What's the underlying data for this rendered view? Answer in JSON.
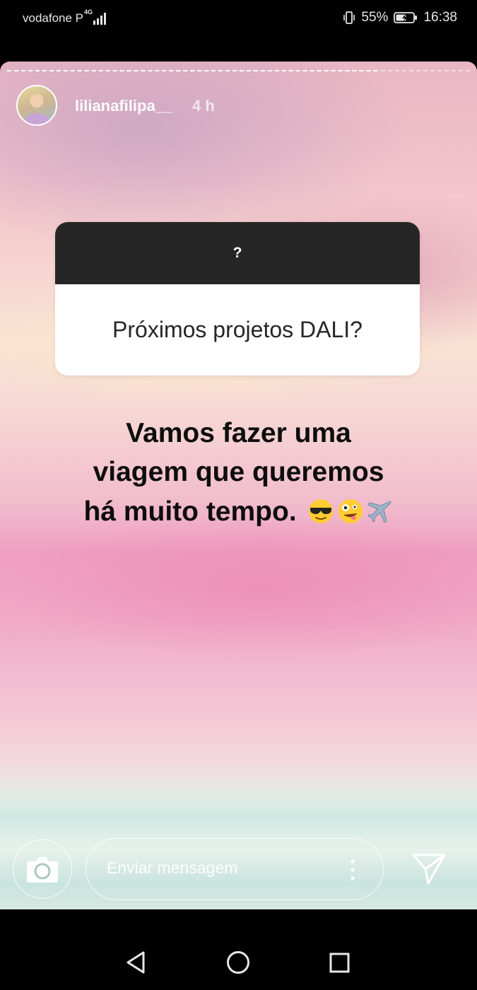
{
  "status_bar": {
    "carrier": "vodafone P",
    "network_type": "4G",
    "battery_percent": "55%",
    "time": "16:38",
    "icons": [
      "signal-icon",
      "vibrate-icon",
      "battery-charging-icon"
    ]
  },
  "story": {
    "progress": 0.8,
    "username": "lilianafilipa__",
    "time_ago": "4 h",
    "question_header": "?",
    "question_text": "Próximos projetos DALI?",
    "answer_lines": [
      "Vamos fazer uma",
      "viagem que queremos",
      "há muito tempo."
    ],
    "answer_emojis": [
      "smiling-face-with-sunglasses",
      "zany-face",
      "airplane"
    ]
  },
  "reply_bar": {
    "message_placeholder": "Enviar mensagem",
    "icons": [
      "camera-icon",
      "more-vertical-icon",
      "send-icon"
    ]
  },
  "nav_bar": {
    "icons": [
      "back-icon",
      "home-icon",
      "recents-icon"
    ]
  },
  "colors": {
    "question_header_bg": "#262626",
    "question_body_bg": "#ffffff",
    "answer_text": "#0d0d0d",
    "sky_pink": "#f1bccd",
    "sea_teal": "#cfe9e2"
  }
}
